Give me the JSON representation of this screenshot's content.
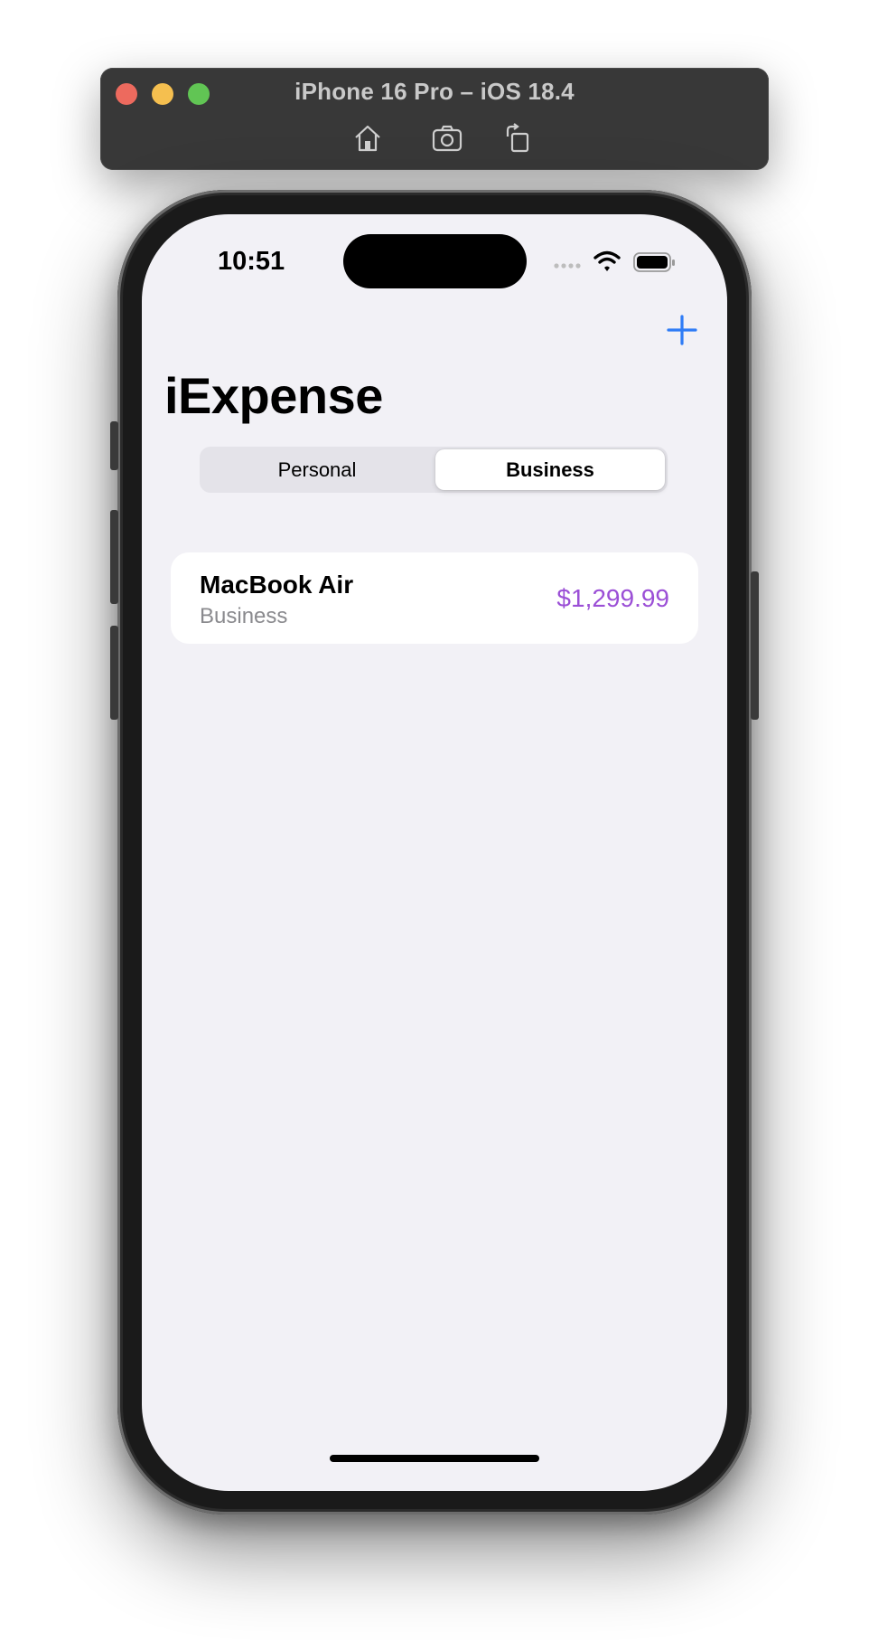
{
  "simulator": {
    "title": "iPhone 16 Pro – iOS 18.4",
    "toolbar": {
      "home_icon": "home-icon",
      "screenshot_icon": "camera-icon",
      "rotate_icon": "rotate-icon"
    }
  },
  "status_bar": {
    "time": "10:51",
    "icons": [
      "cellular-signal-icon",
      "wifi-icon",
      "battery-icon"
    ]
  },
  "nav": {
    "title": "iExpense",
    "add_icon": "+",
    "accent_color": "#2f7cf6"
  },
  "segmented_control": {
    "options": [
      "Personal",
      "Business"
    ],
    "selected": "Business"
  },
  "expenses": [
    {
      "name": "MacBook Air",
      "type": "Business",
      "amount": "$1,299.99",
      "amount_color": "#9b4fd6"
    }
  ]
}
